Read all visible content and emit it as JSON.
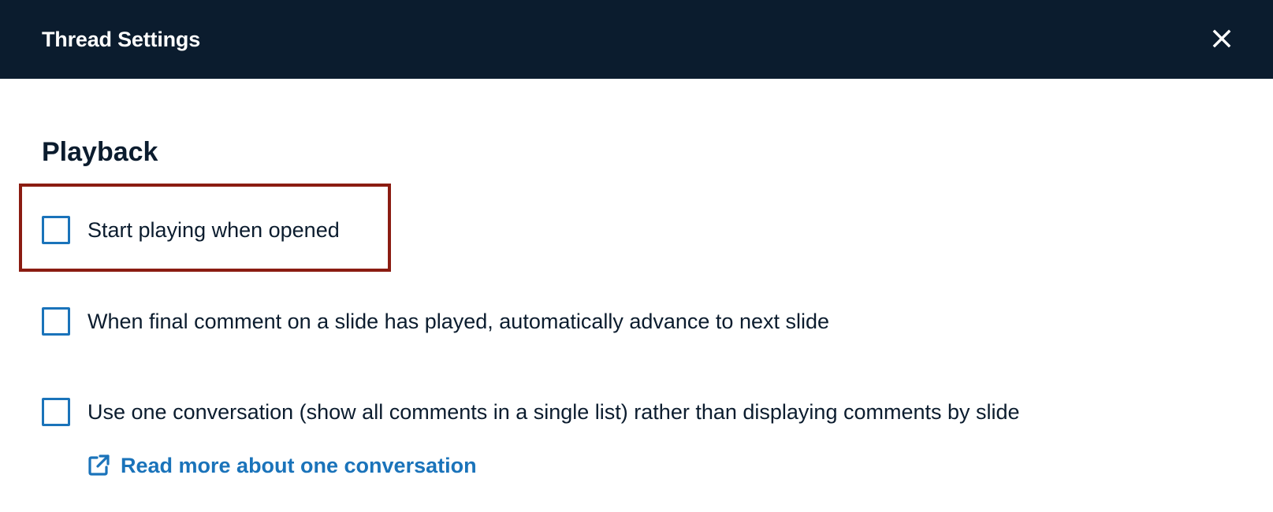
{
  "dialog": {
    "title": "Thread Settings",
    "close_icon": "close-icon"
  },
  "playback": {
    "section_title": "Playback",
    "options": [
      {
        "label": "Start playing when opened",
        "checked": false,
        "highlighted": true
      },
      {
        "label": "When final comment on a slide has played, automatically advance to next slide",
        "checked": false
      },
      {
        "label": "Use one conversation (show all comments in a single list) rather than displaying comments by slide",
        "checked": false
      }
    ],
    "read_more": {
      "label": "Read more about one conversation",
      "icon": "external-link-icon"
    }
  },
  "colors": {
    "header_bg": "#0b1c2e",
    "accent": "#1a73ba",
    "highlight": "#8b1c12",
    "text": "#0b1c2e"
  }
}
